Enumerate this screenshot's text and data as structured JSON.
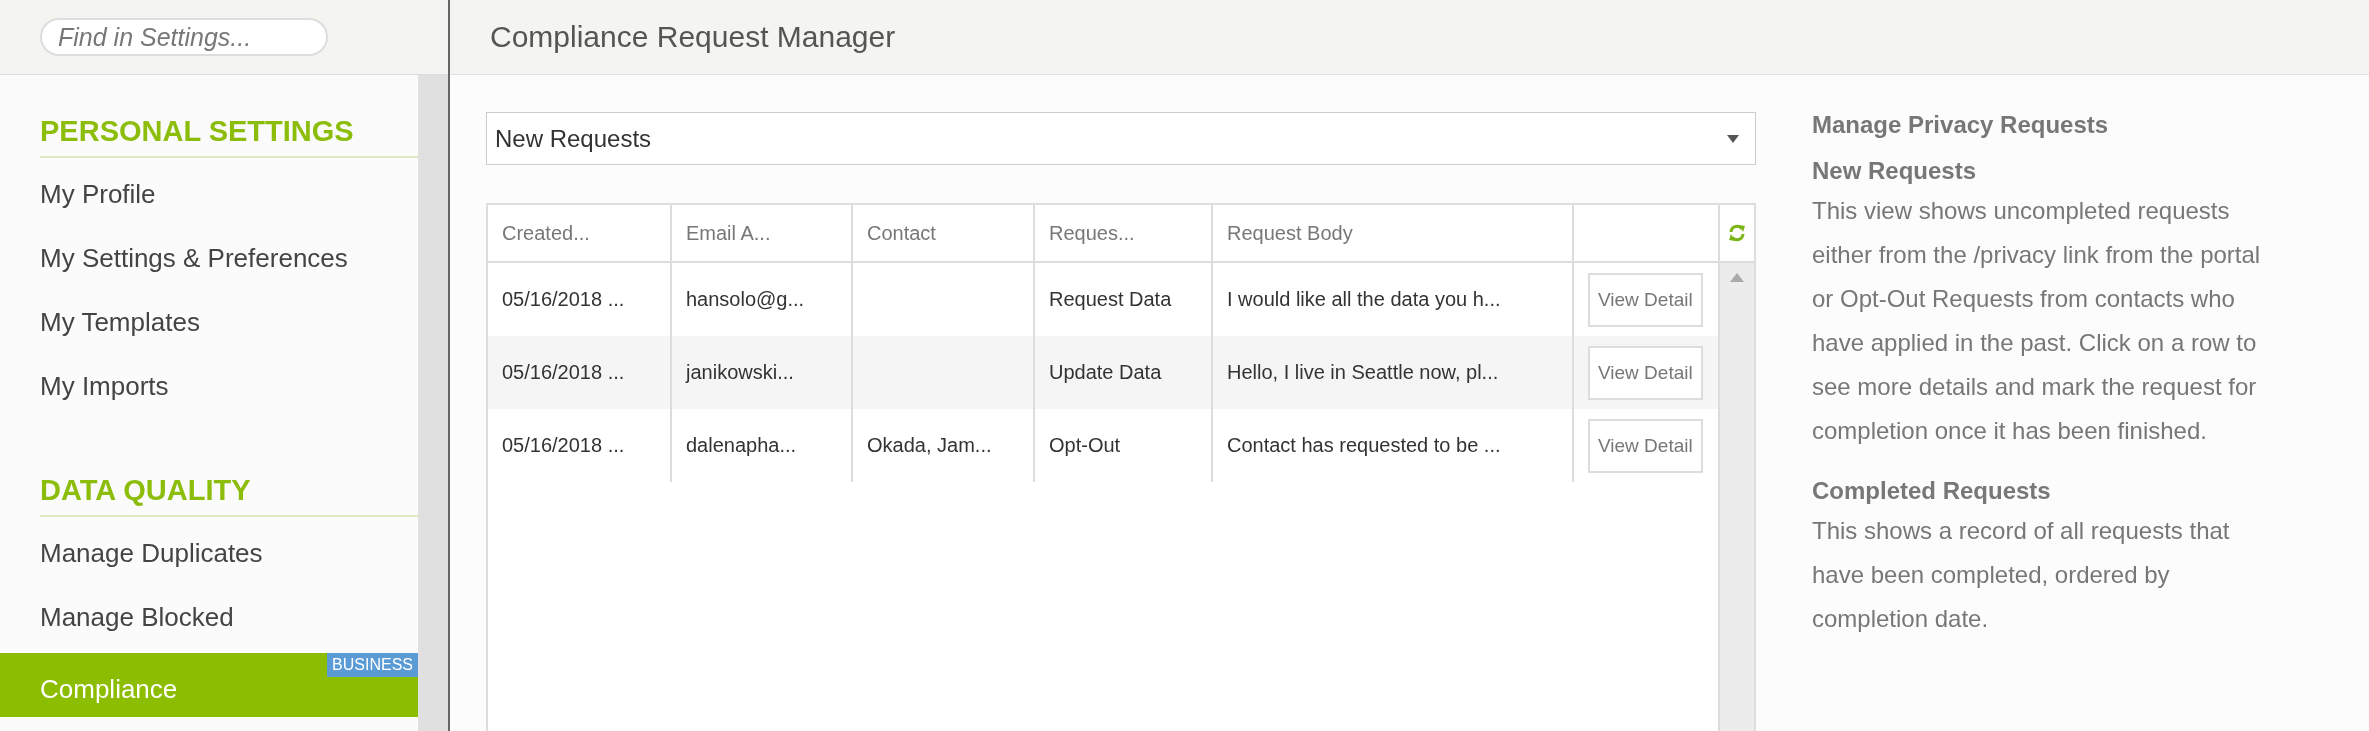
{
  "search": {
    "placeholder": "Find in Settings..."
  },
  "sidebar": {
    "sections": [
      {
        "heading": "PERSONAL SETTINGS",
        "items": [
          {
            "label": "My Profile",
            "selected": false
          },
          {
            "label": "My Settings & Preferences",
            "selected": false
          },
          {
            "label": "My Templates",
            "selected": false
          },
          {
            "label": "My Imports",
            "selected": false
          }
        ]
      },
      {
        "heading": "DATA QUALITY",
        "items": [
          {
            "label": "Manage Duplicates",
            "selected": false
          },
          {
            "label": "Manage Blocked",
            "selected": false
          },
          {
            "label": "Compliance",
            "selected": true,
            "badge": "BUSINESS"
          }
        ]
      }
    ]
  },
  "page_title": "Compliance Request Manager",
  "view_select": {
    "value": "New Requests"
  },
  "table": {
    "columns": [
      "Created...",
      "Email A...",
      "Contact",
      "Reques...",
      "Request Body"
    ],
    "rows": [
      {
        "cells": [
          "05/16/2018 ...",
          "hansolo@g...",
          "",
          "Request Data",
          "I would like all the data you h..."
        ],
        "action": "View Detail"
      },
      {
        "cells": [
          "05/16/2018 ...",
          "janikowski...",
          "",
          "Update Data",
          "Hello, I live in Seattle now, pl..."
        ],
        "action": "View Detail"
      },
      {
        "cells": [
          "05/16/2018 ...",
          "dalenapha...",
          "Okada, Jam...",
          "Opt-Out",
          "Contact has requested to be ..."
        ],
        "action": "View Detail"
      }
    ]
  },
  "help": {
    "title": "Manage Privacy Requests",
    "sections": [
      {
        "heading": "New Requests",
        "text": "This view shows uncompleted requests either from the /privacy link from the portal or Opt-Out Requests from contacts who have applied in the past. Click on a row to see more details and mark the request for completion once it has been finished."
      },
      {
        "heading": "Completed Requests",
        "text": "This shows a record of all requests that have been completed, ordered by completion date."
      }
    ]
  }
}
